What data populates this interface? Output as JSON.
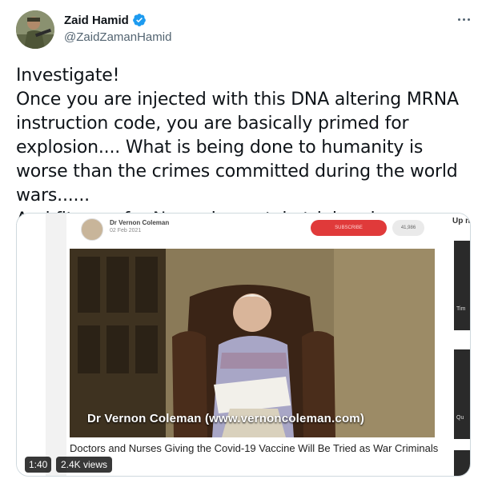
{
  "author": {
    "display_name": "Zaid Hamid",
    "handle": "@ZaidZamanHamid",
    "verified": true
  },
  "tweet": {
    "text": "Investigate!\nOnce you are injected with this DNA altering MRNA instruction code, you are basically primed for explosion.... What is being done to humanity is worse than the crimes committed during the world wars......\nAnd fit case for Nuremberg style trial and convictions...."
  },
  "media": {
    "channel_name": "Dr Vernon Coleman",
    "channel_date": "02 Feb 2021",
    "subscribe_label": "SUBSCRIBE",
    "subscriber_count": "41,986",
    "video_caption": "Dr Vernon Coleman (www.vernoncoleman.com)",
    "video_title": "Doctors and Nurses Giving the Covid-19 Vaccine Will Be Tried as War Criminals",
    "up_next_label": "Up n",
    "thumb_labels": [
      "Tim",
      "Qu"
    ],
    "duration": "1:40",
    "views": "2.4K views"
  },
  "colors": {
    "verified_blue": "#1d9bf0",
    "text_primary": "#0f1419",
    "text_secondary": "#536471",
    "subscribe_red": "#e03a3a"
  },
  "icons": [
    "verified-badge-icon",
    "more-options-icon"
  ]
}
